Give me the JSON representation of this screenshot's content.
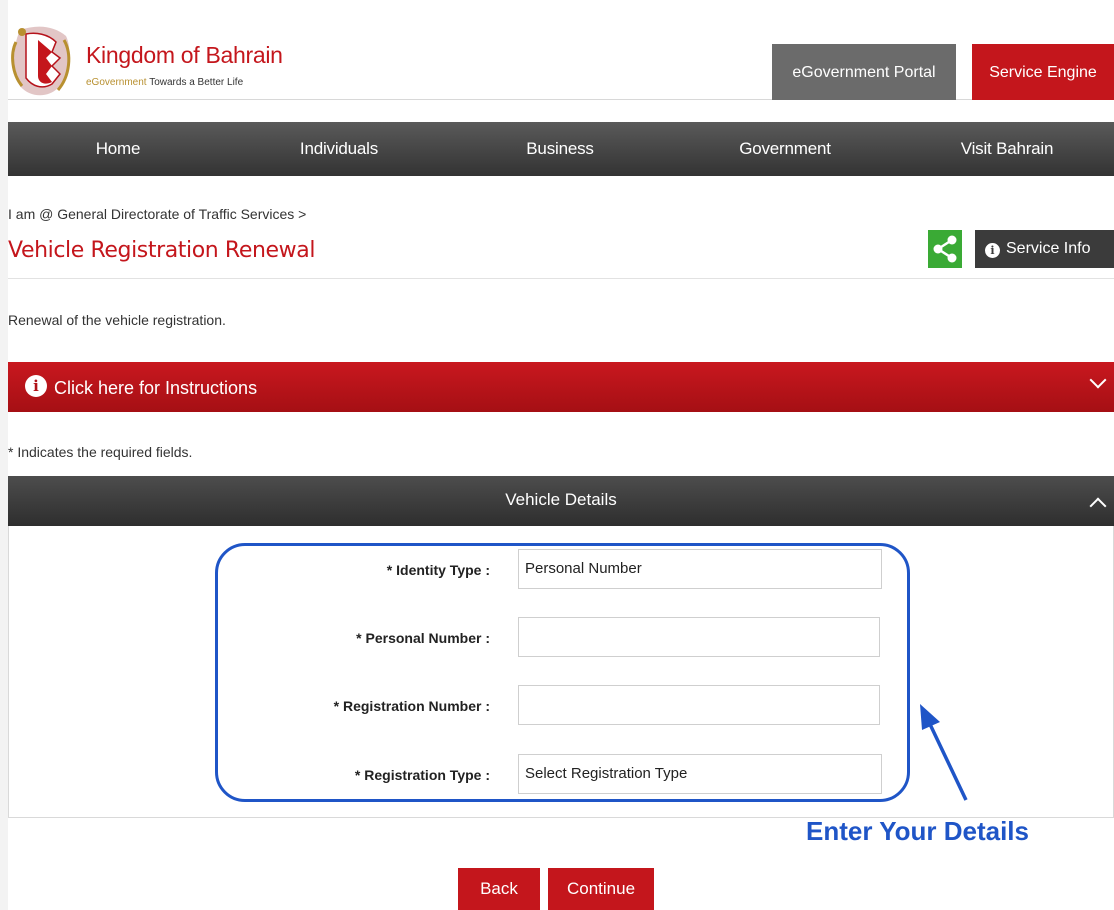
{
  "header": {
    "brand_title": "Kingdom of Bahrain",
    "brand_tagline_prefix": "eGovernment",
    "brand_tagline_suffix": "Towards a Better Life",
    "egov_portal_label": "eGovernment Portal",
    "service_engine_label": "Service Engine"
  },
  "nav": {
    "items": [
      "Home",
      "Individuals",
      "Business",
      "Government",
      "Visit Bahrain"
    ]
  },
  "breadcrumb": "I am @ General Directorate of Traffic Services >",
  "page_title": "Vehicle Registration Renewal",
  "service_info_label": "Service Info",
  "description": "Renewal of the vehicle registration.",
  "instructions_label": "Click here for Instructions",
  "required_note": "* Indicates the required fields.",
  "panel": {
    "title": "Vehicle Details",
    "fields": [
      {
        "label": "* Identity Type :",
        "value": "Personal Number"
      },
      {
        "label": "* Personal Number :",
        "value": ""
      },
      {
        "label": "* Registration Number :",
        "value": ""
      },
      {
        "label": "* Registration Type :",
        "value": "Select Registration Type"
      }
    ]
  },
  "callout_text": "Enter Your Details",
  "buttons": {
    "back": "Back",
    "continue": "Continue"
  },
  "colors": {
    "brand_red": "#c4161c",
    "nav_dark": "#3b3b3b",
    "share_green": "#3aaa35",
    "callout_blue": "#1f55c7"
  }
}
